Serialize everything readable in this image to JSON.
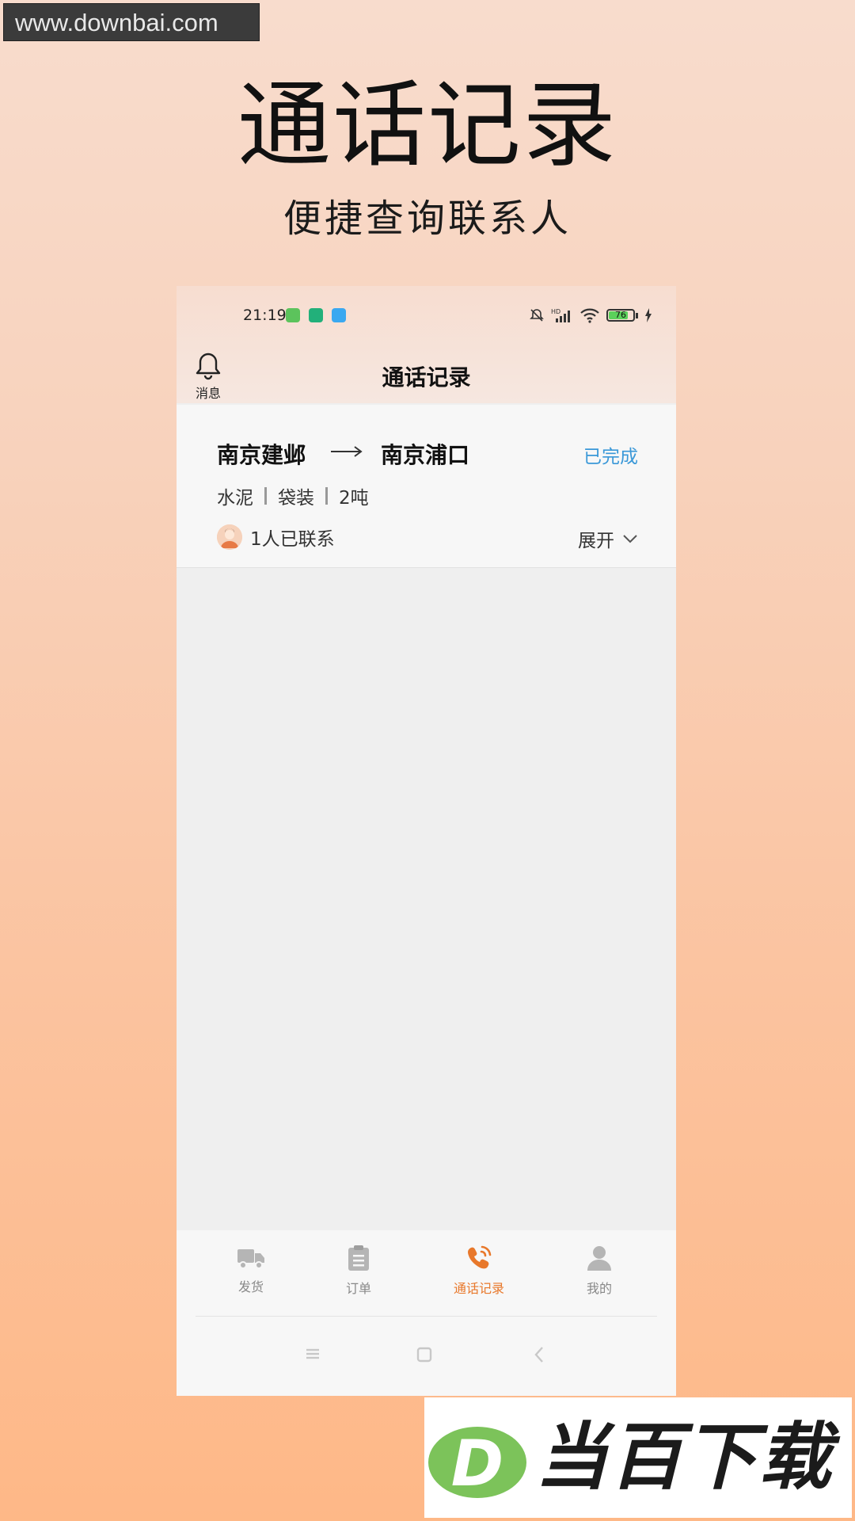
{
  "watermark": "www.downbai.com",
  "promo": {
    "title": "通话记录",
    "subtitle": "便捷查询联系人"
  },
  "status_bar": {
    "time": "21:19",
    "battery_level": "76",
    "network": "HD"
  },
  "header": {
    "message_label": "消息",
    "title": "通话记录"
  },
  "order_card": {
    "from": "南京建邺",
    "to": "南京浦口",
    "status": "已完成",
    "goods": [
      "水泥",
      "袋装",
      "2吨"
    ],
    "contacted": "1人已联系",
    "expand_label": "展开"
  },
  "tabbar": {
    "tabs": [
      {
        "label": "发货",
        "icon": "truck-icon"
      },
      {
        "label": "订单",
        "icon": "clipboard-icon"
      },
      {
        "label": "通话记录",
        "icon": "phone-icon"
      },
      {
        "label": "我的",
        "icon": "user-icon"
      }
    ],
    "active_index": 2
  },
  "colors": {
    "accent": "#e8782b",
    "status_done": "#3a98d8"
  },
  "logo": {
    "letter": "D",
    "text": "当百下载"
  }
}
